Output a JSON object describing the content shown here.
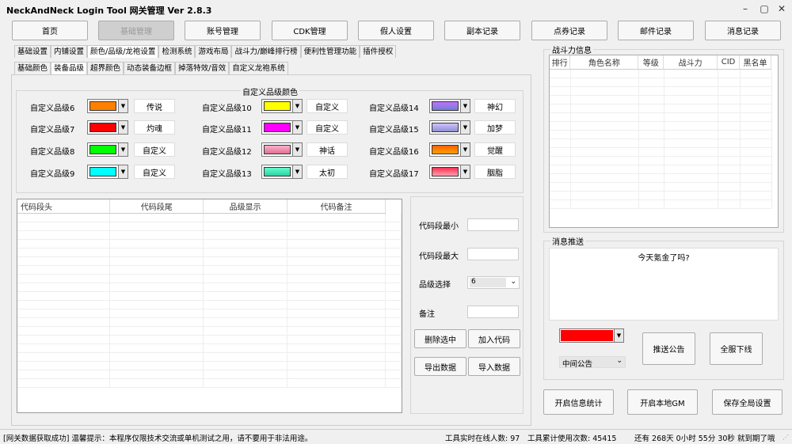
{
  "app": {
    "title": "NeckAndNeck Login Tool 网关管理 Ver 2.8.3"
  },
  "nav": [
    "首页",
    "基础管理",
    "账号管理",
    "CDK管理",
    "假人设置",
    "副本记录",
    "点券记录",
    "邮件记录",
    "消息记录"
  ],
  "tabs1": [
    "基础设置",
    "内铺设置",
    "颜色/品级/龙袍设置",
    "检测系统",
    "游戏布局",
    "战斗力/巅峰排行榜",
    "便利性管理功能",
    "插件授权"
  ],
  "tabs2": [
    "基础颜色",
    "装备品级",
    "超界颜色",
    "动态装备边框",
    "掉落特效/音效",
    "自定义龙袍系统"
  ],
  "quality": {
    "title": "自定义品级颜色",
    "items": [
      {
        "label": "自定义品级6",
        "color": "#ff8000",
        "name": "传说"
      },
      {
        "label": "自定义品级7",
        "color": "#ff0000",
        "name": "灼魂"
      },
      {
        "label": "自定义品级8",
        "color": "#00ff00",
        "name": "自定义"
      },
      {
        "label": "自定义品级9",
        "color": "#00ffff",
        "name": "自定义"
      },
      {
        "label": "自定义品级10",
        "color": "#ffff00",
        "name": "自定义"
      },
      {
        "label": "自定义品级11",
        "color": "#ff00ff",
        "name": "自定义"
      },
      {
        "label": "自定义品级12",
        "color": "linear-gradient(#ffb0d0,#e07090)",
        "name": "神话"
      },
      {
        "label": "自定义品级13",
        "color": "linear-gradient(#60ffd0,#30d0a0)",
        "name": "太初"
      },
      {
        "label": "自定义品级14",
        "color": "linear-gradient(#c070ff,#7080d0)",
        "name": "神幻"
      },
      {
        "label": "自定义品级15",
        "color": "linear-gradient(#d0c0ff,#9090d0)",
        "name": "加梦"
      },
      {
        "label": "自定义品级16",
        "color": "linear-gradient(#ff6000,#ffa000)",
        "name": "觉醒"
      },
      {
        "label": "自定义品级17",
        "color": "linear-gradient(#ff3050,#ffa0b0)",
        "name": "胭脂"
      }
    ]
  },
  "code_grid": {
    "headers": [
      "代码段头",
      "代码段尾",
      "品级显示",
      "代码备注"
    ]
  },
  "code_form": {
    "min_label": "代码段最小",
    "max_label": "代码段最大",
    "quality_label": "品级选择",
    "quality_value": "6",
    "note_label": "备注",
    "delete_btn": "删除选中",
    "add_btn": "加入代码",
    "export_btn": "导出数据",
    "import_btn": "导入数据"
  },
  "combat": {
    "title": "战斗力信息",
    "headers": [
      "排行",
      "角色名称",
      "等级",
      "战斗力",
      "CID",
      "黑名单"
    ]
  },
  "push": {
    "title": "消息推送",
    "message": "今天氪金了吗?",
    "color": "#ff0000",
    "position": "中间公告",
    "push_btn": "推送公告",
    "offline_btn": "全服下线"
  },
  "bottom_btns": {
    "stats": "开启信息统计",
    "gm": "开启本地GM",
    "save": "保存全局设置"
  },
  "status": {
    "left": "[网关数据获取成功] 温馨提示：本程序仅限技术交流或单机测试之用，请不要用于非法用途。",
    "online": "工具实时在线人数: 97",
    "usage": "工具累计使用次数: 45415",
    "expire": "还有 268天 0小时 55分 30秒 就到期了哦"
  }
}
